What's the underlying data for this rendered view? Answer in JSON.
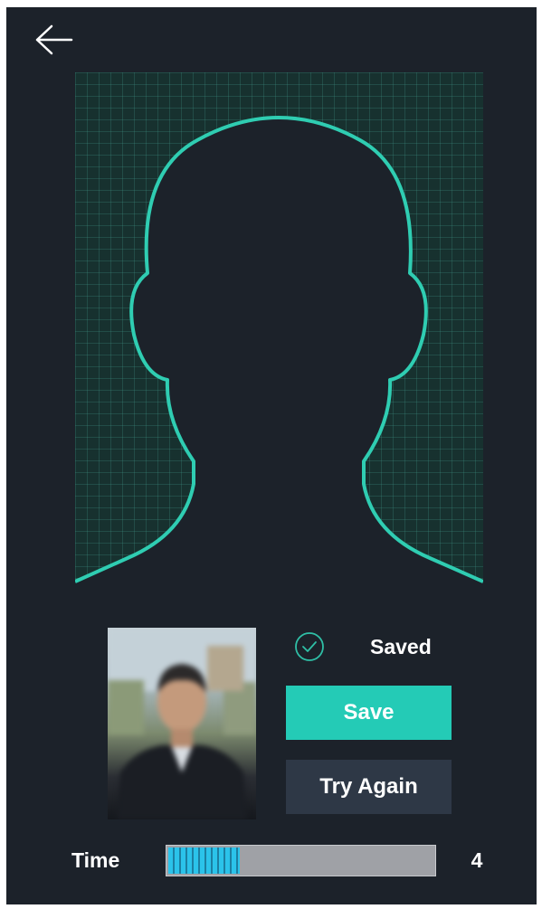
{
  "header": {
    "back_icon": "arrow-left-icon"
  },
  "camera": {
    "outline_color": "#2fcdb2",
    "guide_icon": "head-silhouette-outline"
  },
  "status": {
    "icon": "check-circle-icon",
    "label": "Saved"
  },
  "actions": {
    "save_label": "Save",
    "try_again_label": "Try Again"
  },
  "timer": {
    "label": "Time",
    "value": "4",
    "progress": 0.27
  },
  "colors": {
    "background": "#1c222a",
    "accent": "#24cbb6",
    "secondary_button": "#2e3846",
    "progress_fill": "#2bc3ea"
  }
}
